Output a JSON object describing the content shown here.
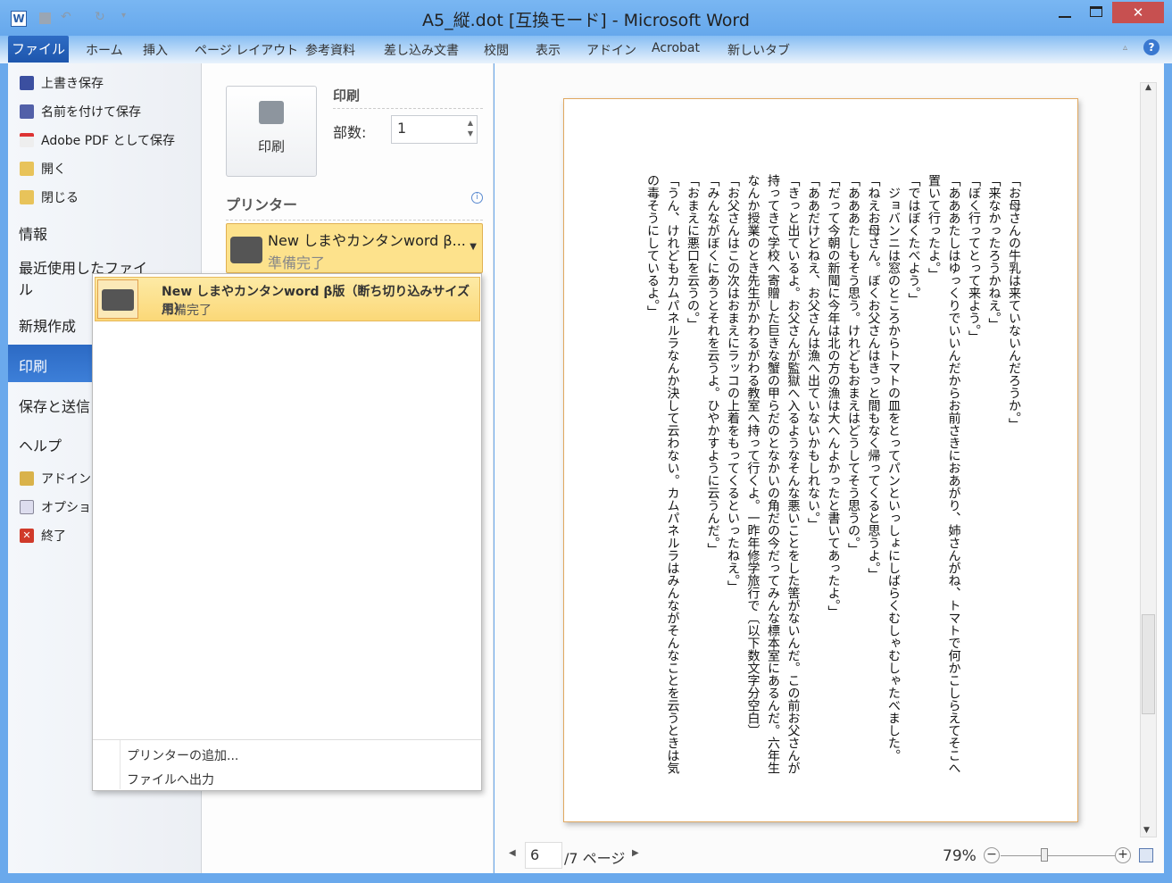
{
  "window": {
    "title": "A5_縦.dot [互換モード] - Microsoft Word",
    "app_icon": "word-icon",
    "colors": {
      "frame": "#6aa9ec",
      "file_tab": "#1f5fb5",
      "close": "#c75050",
      "selection": "#fde28c"
    }
  },
  "ribbon": {
    "file_tab": "ファイル",
    "tabs": [
      "ホーム",
      "挿入",
      "ページ レイアウト",
      "参考資料",
      "差し込み文書",
      "校閲",
      "表示",
      "アドイン",
      "Acrobat",
      "新しいタブ"
    ]
  },
  "backstage": {
    "commands": [
      {
        "label": "上書き保存",
        "icon": "save-icon"
      },
      {
        "label": "名前を付けて保存",
        "icon": "save-as-icon"
      },
      {
        "label": "Adobe PDF として保存",
        "icon": "pdf-icon"
      },
      {
        "label": "開く",
        "icon": "open-folder-icon"
      },
      {
        "label": "閉じる",
        "icon": "close-folder-icon"
      }
    ],
    "sections": [
      "情報",
      "最近使用したファイル",
      "新規作成",
      "印刷",
      "保存と送信",
      "ヘルプ"
    ],
    "selected": "印刷",
    "bottom": [
      {
        "label": "アドイン",
        "icon": "addin-icon"
      },
      {
        "label": "オプション",
        "icon": "options-icon"
      },
      {
        "label": "終了",
        "icon": "exit-icon"
      }
    ]
  },
  "print": {
    "button_label": "印刷",
    "heading": "印刷",
    "copies_label": "部数:",
    "copies_value": "1",
    "printer_heading": "プリンター",
    "printer_name_short": "New しまやカンタンword β...",
    "printer_status": "準備完了",
    "dropdown": {
      "printer_name": "New しまやカンタンword β版（断ち切り込みサイズ用）",
      "printer_status": "準備完了",
      "add_printer": "プリンターの追加...",
      "print_to_file": "ファイルへ出力"
    }
  },
  "preview": {
    "columns": [
      "「お母さんの牛乳は来ていないんだろうか。」",
      "「来なかったろうかねえ。」",
      "「ぼく行ってとって来よう。」",
      "「あああたしはゆっくりでいいんだからお前さきにおあがり、姉さんがね、トマトで何かこしらえてそこへ",
      "置いて行ったよ。」",
      "「ではぼくたべよう。」",
      "　ジョバンニは窓のところからトマトの皿をとってパンといっしょにしばらくむしゃむしゃたべました。",
      "「ねえお母さん。ぼくお父さんはきっと間もなく帰ってくると思うよ。」",
      "「あああたしもそう思う。けれどもおまえはどうしてそう思うの。」",
      "「だって今朝の新聞に今年は北の方の漁は大へんよかったと書いてあったよ。」",
      "「ああだけどねえ、お父さんは漁へ出ていないかもしれない。」",
      "「きっと出ているよ。お父さんが監獄へ入るようなそんな悪いことをした筈がないんだ。この前お父さんが",
      "持ってきて学校へ寄贈した巨きな蟹の甲らだのとなかいの角だの今だってみんな標本室にあるんだ。六年生",
      "なんか授業のとき先生がかわるがわる教室へ持って行くよ。一昨年修学旅行で〔以下数文字分空白〕",
      "「お父さんはこの次はおまえにラッコの上着をもってくるといったねえ。」",
      "「みんながぼくにあうとそれを云うよ。ひやかすように云うんだ。」",
      "「おまえに悪口を云うの。」",
      "「うん、けれどもカムパネルラなんか決して云わない。カムパネルラはみんながそんなことを云うときは気",
      "の毒そうにしているよ。」"
    ],
    "page_current": "6",
    "page_total": "/7 ページ",
    "zoom": "79%",
    "zoom_percent": 79
  }
}
